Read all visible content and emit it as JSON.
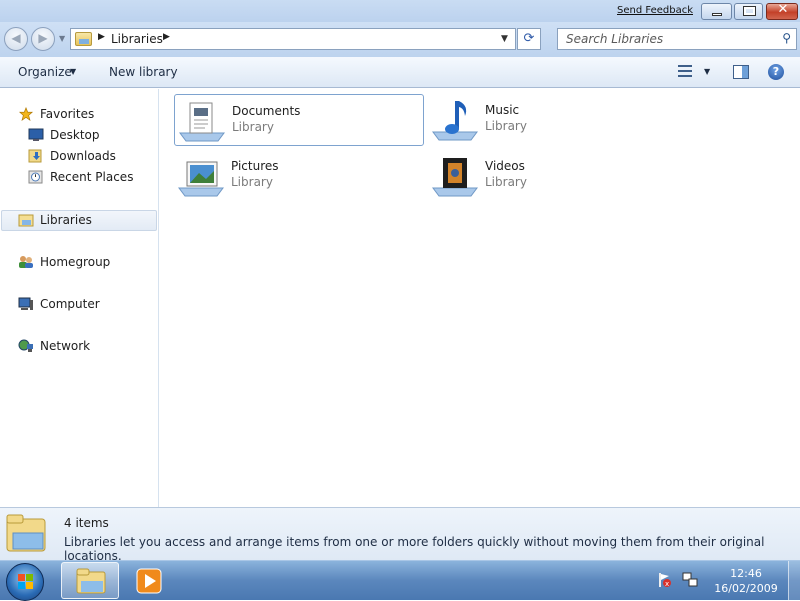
{
  "titlebar": {
    "feedback_link": "Send Feedback",
    "window_buttons": [
      "minimize-icon",
      "maximize-icon",
      "close-icon"
    ]
  },
  "address": {
    "breadcrumb": "Libraries",
    "search_placeholder": "Search Libraries"
  },
  "commandbar": {
    "organize": "Organize",
    "new_library": "New library",
    "icons": [
      "views-icon",
      "preview-pane-icon",
      "help-icon"
    ]
  },
  "nav": {
    "favorites": {
      "label": "Favorites",
      "items": [
        {
          "label": "Desktop",
          "icon": "desktop-icon"
        },
        {
          "label": "Downloads",
          "icon": "downloads-icon"
        },
        {
          "label": "Recent Places",
          "icon": "recent-places-icon"
        }
      ]
    },
    "libraries": "Libraries",
    "homegroup": "Homegroup",
    "computer": "Computer",
    "network": "Network"
  },
  "content": {
    "items": [
      {
        "name": "Documents",
        "type": "Library",
        "icon": "documents-library-icon",
        "selected": true
      },
      {
        "name": "Music",
        "type": "Library",
        "icon": "music-library-icon",
        "selected": false
      },
      {
        "name": "Pictures",
        "type": "Library",
        "icon": "pictures-library-icon",
        "selected": false
      },
      {
        "name": "Videos",
        "type": "Library",
        "icon": "videos-library-icon",
        "selected": false
      }
    ]
  },
  "details": {
    "count": "4 items",
    "description": "Libraries let you access and arrange items from one or more folders quickly without moving them from their original locations."
  },
  "taskbar": {
    "time": "12:46",
    "date": "16/02/2009",
    "pinned": [
      "windows-explorer-icon",
      "windows-media-player-icon"
    ],
    "tray": [
      "action-center-icon",
      "network-icon"
    ]
  },
  "colors": {
    "chrome": "#bcd2ee",
    "selection_border": "#7ea3cf",
    "taskbar": "#5b87bd"
  }
}
